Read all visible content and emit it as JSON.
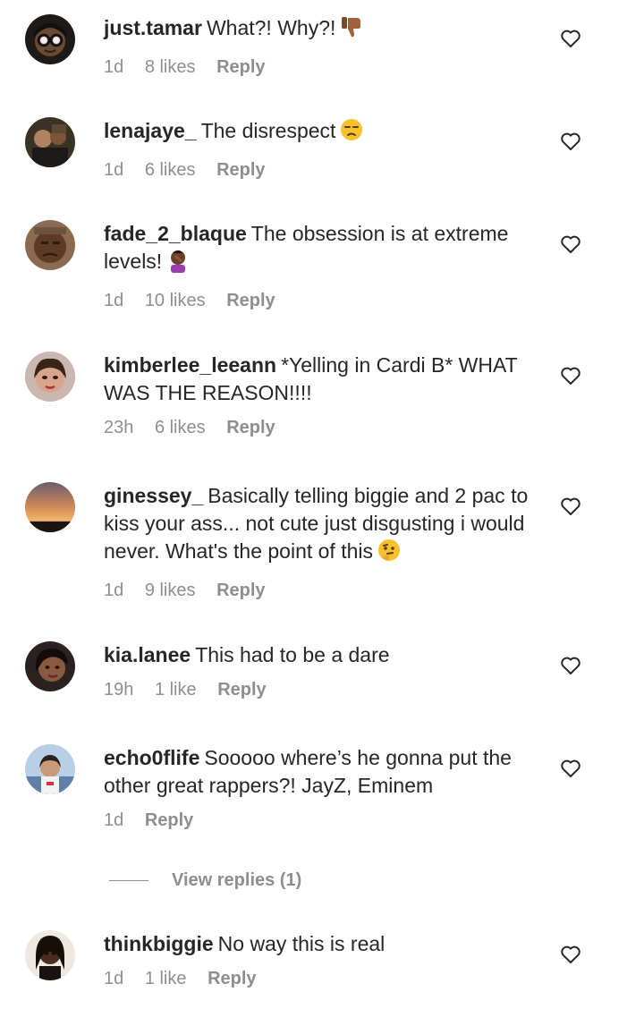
{
  "comments": [
    {
      "username": "just.tamar",
      "text": "What?! Why?!",
      "emoji": "thumbs-down",
      "time": "1d",
      "likes": "8 likes",
      "reply": "Reply"
    },
    {
      "username": "lenajaye_",
      "text": "The disrespect",
      "emoji": "unamused-face",
      "time": "1d",
      "likes": "6 likes",
      "reply": "Reply"
    },
    {
      "username": "fade_2_blaque",
      "text": "The obsession is at extreme levels!",
      "emoji": "facepalm",
      "time": "1d",
      "likes": "10 likes",
      "reply": "Reply"
    },
    {
      "username": "kimberlee_leeann",
      "text": "*Yelling in Cardi B* WHAT WAS THE REASON!!!!",
      "time": "23h",
      "likes": "6 likes",
      "reply": "Reply"
    },
    {
      "username": "ginessey_",
      "text": "Basically telling biggie and 2 pac to kiss your ass... not cute just disgusting i would never. What's the point of this",
      "emoji": "thinking-face",
      "time": "1d",
      "likes": "9 likes",
      "reply": "Reply"
    },
    {
      "username": "kia.lanee",
      "text": "This had to be a dare",
      "time": "19h",
      "likes": "1 like",
      "reply": "Reply"
    },
    {
      "username": "echo0flife",
      "text": "Sooooo where’s he gonna put the other great rappers?! JayZ, Eminem",
      "time": "1d",
      "reply": "Reply"
    },
    {
      "username": "thinkbiggie",
      "text": "No way this is real",
      "time": "1d",
      "likes": "1 like",
      "reply": "Reply"
    }
  ],
  "view_replies": "View replies (1)",
  "icons": {
    "like": "heart-outline-icon"
  },
  "colors": {
    "primary_text": "#262626",
    "secondary_text": "#8e8e8e",
    "background": "#ffffff"
  }
}
